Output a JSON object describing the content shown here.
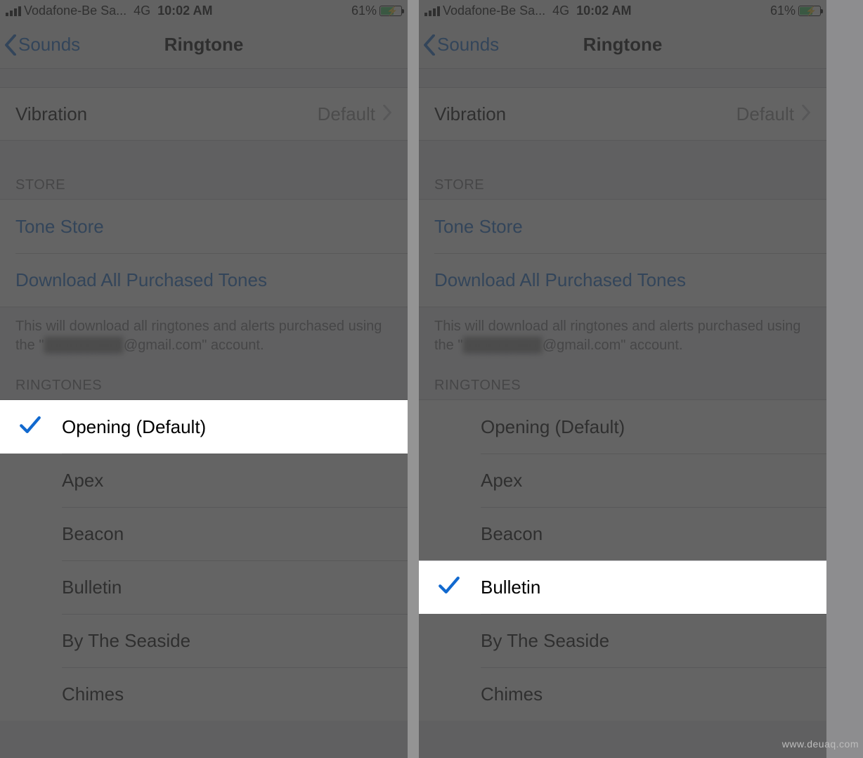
{
  "status": {
    "carrier": "Vodafone-Be Sa...",
    "network": "4G",
    "time": "10:02 AM",
    "battery_pct": "61%"
  },
  "nav": {
    "back_label": "Sounds",
    "title": "Ringtone"
  },
  "vibration": {
    "label": "Vibration",
    "value": "Default"
  },
  "sections": {
    "store_header": "STORE",
    "tone_store": "Tone Store",
    "download_all": "Download All Purchased Tones",
    "footer_pre": "This will download all ringtones and alerts purchased using the \"",
    "footer_email_redacted": "████████",
    "footer_email_domain": "@gmail.com",
    "footer_post": "\" account.",
    "ringtones_header": "RINGTONES"
  },
  "ringtones": [
    {
      "label": "Opening (Default)"
    },
    {
      "label": "Apex"
    },
    {
      "label": "Beacon"
    },
    {
      "label": "Bulletin"
    },
    {
      "label": "By The Seaside"
    },
    {
      "label": "Chimes"
    }
  ],
  "screens": {
    "left_selected_index": 0,
    "right_selected_index": 3
  },
  "watermark": "www.deuaq.com"
}
